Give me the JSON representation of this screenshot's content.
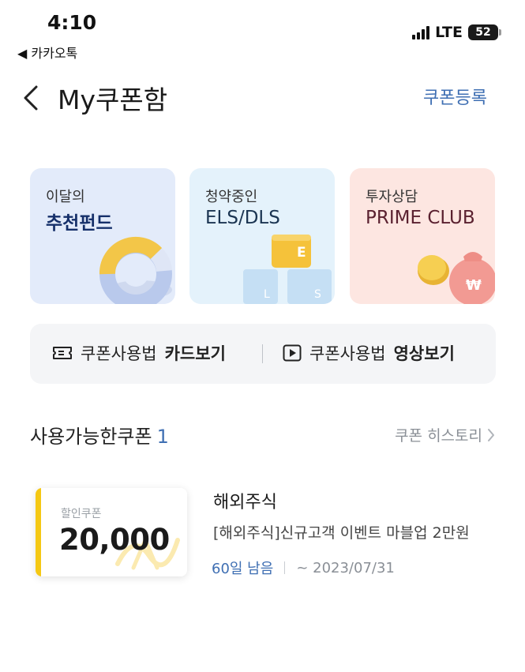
{
  "status_bar": {
    "time": "4:10",
    "back_app": "◀ 카카오톡",
    "network": "LTE",
    "battery": "52"
  },
  "header": {
    "title": "My쿠폰함",
    "register_link": "쿠폰등록"
  },
  "promo_cards": [
    {
      "subtitle": "이달의",
      "title": "추천펀드",
      "icon": "donut-chart-icon",
      "bg": "#e3ebfa"
    },
    {
      "subtitle": "청약중인",
      "title": "ELS/DLS",
      "icon": "els-blocks-icon",
      "bg": "#e4f2fb",
      "block_letters": [
        "E",
        "L",
        "S"
      ]
    },
    {
      "subtitle": "투자상담",
      "title": "PRIME CLUB",
      "icon": "money-bag-icon",
      "bg": "#fde6e1",
      "bag_symbol": "₩"
    }
  ],
  "guide": {
    "card_guide_prefix": "쿠폰사용법",
    "card_guide_bold": "카드보기",
    "video_guide_prefix": "쿠폰사용법",
    "video_guide_bold": "영상보기"
  },
  "coupon_section": {
    "title": "사용가능한쿠폰",
    "count": "1",
    "history_link": "쿠폰 히스토리"
  },
  "coupons": [
    {
      "type": "할인쿠폰",
      "amount": "20,000",
      "name": "해외주식",
      "description": "[해외주식]신규고객 이벤트 마블업 2만원",
      "days_left": "60일 남음",
      "expiry": "~ 2023/07/31"
    }
  ],
  "colors": {
    "accent_blue": "#3f6fb3",
    "coupon_stripe": "#f5c814"
  }
}
